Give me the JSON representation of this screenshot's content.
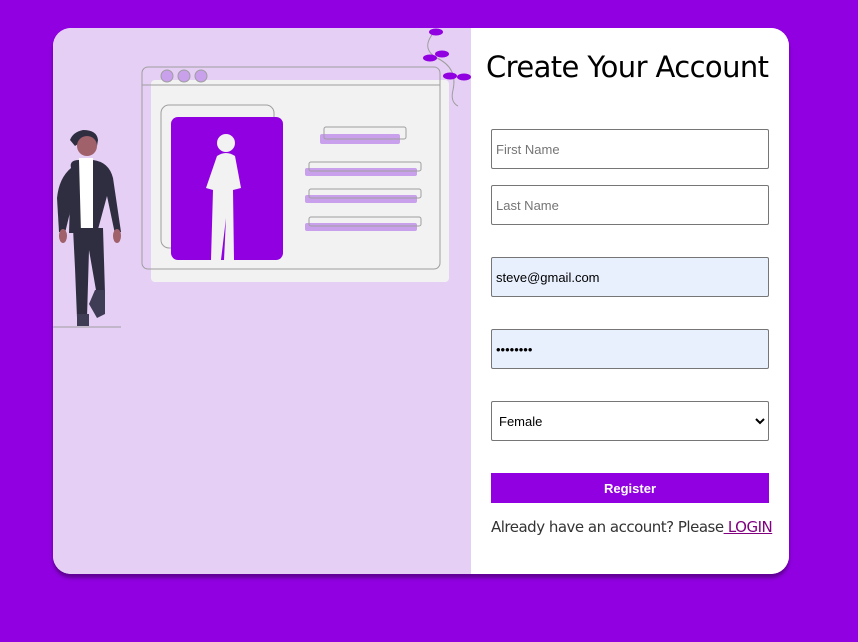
{
  "form": {
    "title": "Create Your Account",
    "first_name": {
      "placeholder": "First Name",
      "value": ""
    },
    "last_name": {
      "placeholder": "Last Name",
      "value": ""
    },
    "email": {
      "value": "steve@gmail.com"
    },
    "password": {
      "value": "12345678"
    },
    "gender": {
      "selected": "Female",
      "options": [
        "Female"
      ]
    },
    "register_label": "Register",
    "login_prompt": "Already have an account? Please",
    "login_link": " LOGIN"
  },
  "colors": {
    "background": "#9000e0",
    "accent": "#9000e0",
    "panel": "#e6cff5",
    "link": "#800080"
  },
  "illustration": {
    "icon": "person-profile-illustration"
  }
}
